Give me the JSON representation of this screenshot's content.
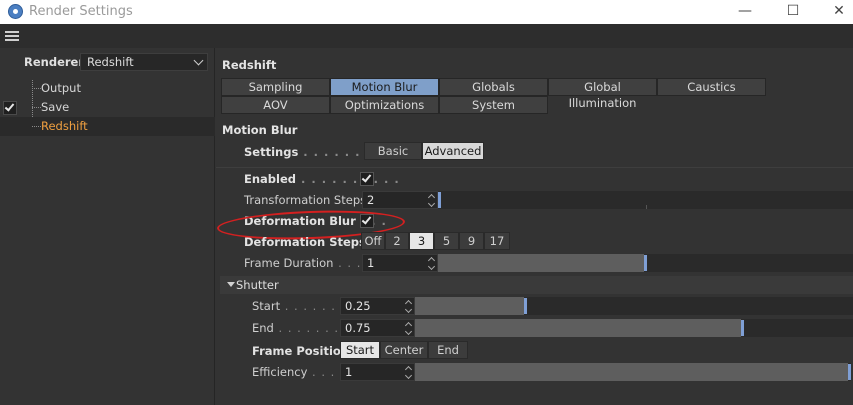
{
  "window": {
    "title": "Render Settings",
    "minimize": "—",
    "maximize": "☐",
    "close": "✕"
  },
  "renderer": {
    "label": "Renderer",
    "value": "Redshift"
  },
  "tree": {
    "items": [
      {
        "label": "Output",
        "checked": false
      },
      {
        "label": "Save",
        "checked": true
      },
      {
        "label": "Redshift",
        "checked": false,
        "selected": true
      }
    ]
  },
  "panel": {
    "title": "Redshift",
    "tabs_row1": [
      "Sampling",
      "Motion Blur",
      "Globals",
      "Global Illumination",
      "Caustics"
    ],
    "tabs_row2": [
      "AOV",
      "Optimizations",
      "System"
    ],
    "active_tab": "Motion Blur"
  },
  "motion_blur": {
    "title": "Motion Blur",
    "settings": {
      "label": "Settings",
      "dots": " . . . . . . . . .",
      "options": [
        "Basic",
        "Advanced"
      ],
      "selected": "Advanced"
    },
    "enabled": {
      "label": "Enabled",
      "dots": " . . . . . . . . . .",
      "checked": true
    },
    "transformation_steps": {
      "label": "Transformation Steps",
      "value": "2",
      "slider_fraction": 0.0
    },
    "deformation_blur": {
      "label": "Deformation Blur",
      "dots": " . . .",
      "checked": true
    },
    "deformation_steps": {
      "label": "Deformation Steps",
      "options": [
        "Off",
        "2",
        "3",
        "5",
        "9",
        "17"
      ],
      "selected": "3"
    },
    "frame_duration": {
      "label": "Frame Duration",
      "dots": " . . . .",
      "value": "1",
      "slider_fraction": 0.5
    }
  },
  "shutter": {
    "title": "Shutter",
    "start": {
      "label": "Start",
      "dots": " . . . . . . .",
      "value": "0.25",
      "slider_fraction": 0.25
    },
    "end": {
      "label": "End",
      "dots": " . . . . . . . . .",
      "value": "0.75",
      "slider_fraction": 0.75
    },
    "frame_position": {
      "label": "Frame Position",
      "options": [
        "Start",
        "Center",
        "End"
      ],
      "selected": "Start"
    },
    "efficiency": {
      "label": "Efficiency",
      "dots": " . . . .",
      "value": "1",
      "slider_fraction": 1.0
    }
  },
  "colors": {
    "accent": "#7f9fc9",
    "selected_item": "#f0a040",
    "annotation": "#d42020"
  }
}
